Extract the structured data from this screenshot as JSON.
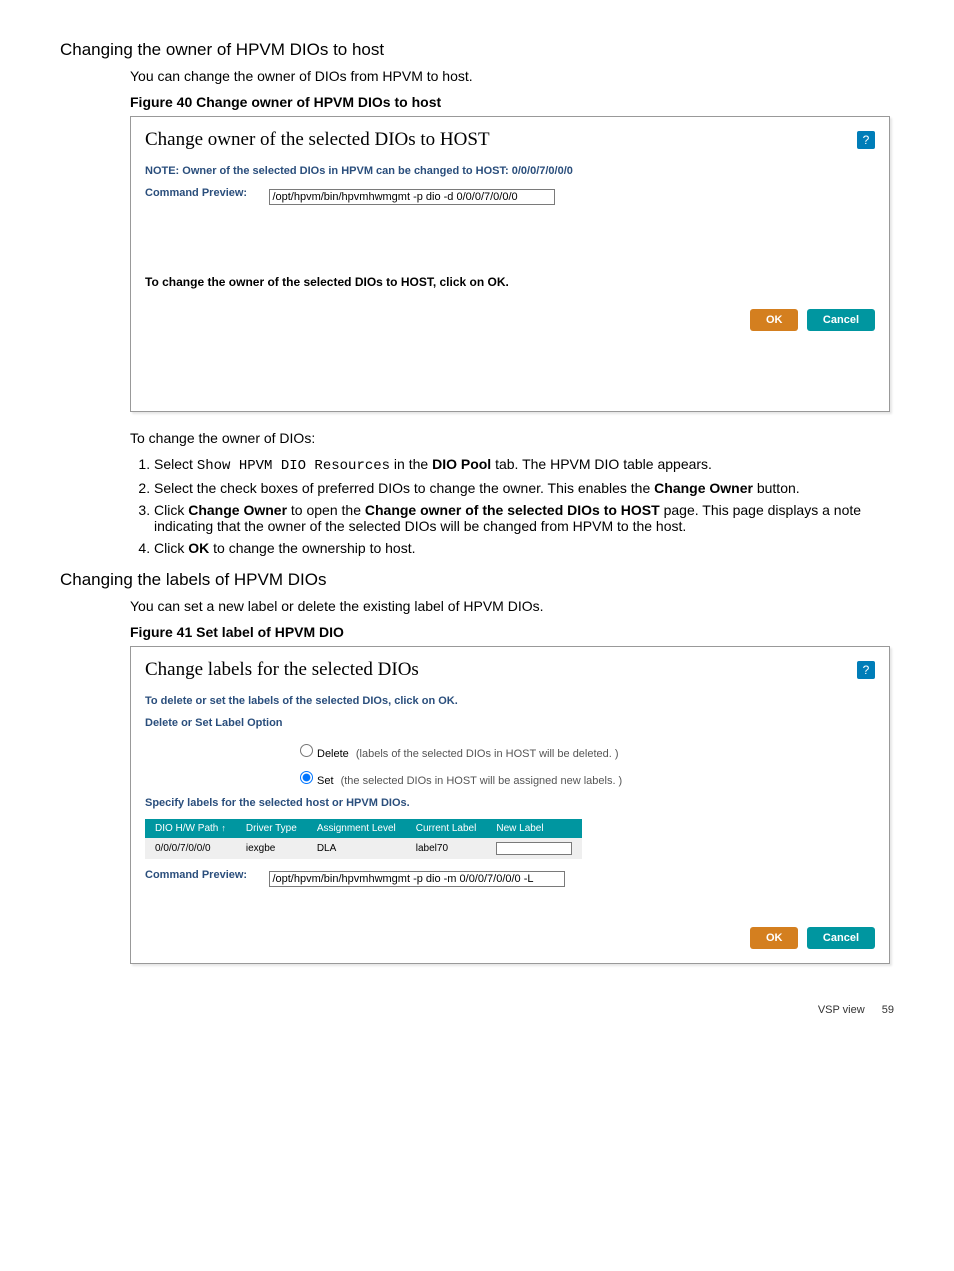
{
  "sections": {
    "s1_heading": "Changing the owner of HPVM DIOs to host",
    "s1_intro": "You can change the owner of DIOs from HPVM to host.",
    "fig40_caption": "Figure 40 Change owner of HPVM DIOs to host",
    "s1_after": "To change the owner of DIOs:",
    "s2_heading": "Changing the labels of HPVM DIOs",
    "s2_intro": "You can set a new label or delete the existing label of HPVM DIOs.",
    "fig41_caption": "Figure 41 Set label of HPVM DIO"
  },
  "fig40": {
    "title": "Change owner of the selected DIOs to HOST",
    "note": "NOTE: Owner of the selected DIOs in HPVM can be changed to HOST: 0/0/0/7/0/0/0",
    "cmd_label": "Command Preview:",
    "cmd_value": "/opt/hpvm/bin/hpvmhwmgmt -p dio -d 0/0/0/7/0/0/0",
    "instruction": "To change the owner of the selected DIOs to HOST, click on OK.",
    "ok": "OK",
    "cancel": "Cancel",
    "help": "?"
  },
  "steps": {
    "s1_pre": "Select ",
    "s1_code": "Show HPVM DIO Resources",
    "s1_mid": " in the ",
    "s1_bold": "DIO Pool",
    "s1_post": " tab. The HPVM DIO table appears.",
    "s2_pre": "Select the check boxes of preferred DIOs to change the owner. This enables the ",
    "s2_bold": "Change Owner",
    "s2_post": " button.",
    "s3_pre": "Click ",
    "s3_bold1": "Change Owner",
    "s3_mid": " to open the ",
    "s3_bold2": "Change owner of the selected DIOs to HOST",
    "s3_post": " page. This page displays a note indicating that the owner of the selected DIOs will be changed from HPVM to the host.",
    "s4_pre": "Click ",
    "s4_bold": "OK",
    "s4_post": " to change the ownership to host."
  },
  "fig41": {
    "title": "Change labels for the selected DIOs",
    "help": "?",
    "instruction_top": "To delete or set the labels of the selected DIOs, click on OK.",
    "option_label": "Delete or Set Label Option",
    "delete_label": "Delete",
    "delete_hint": "(labels of the selected DIOs in HOST will be deleted. )",
    "set_label": "Set",
    "set_hint": "(the selected DIOs in HOST will be assigned new labels. )",
    "specify_label": "Specify labels for the selected host or HPVM DIOs.",
    "cols": {
      "hw": "DIO H/W Path",
      "driver": "Driver Type",
      "assign": "Assignment Level",
      "current": "Current Label",
      "newl": "New Label"
    },
    "row": {
      "hw": "0/0/0/7/0/0/0",
      "driver": "iexgbe",
      "assign": "DLA",
      "current": "label70",
      "newl": ""
    },
    "cmd_label": "Command Preview:",
    "cmd_value": "/opt/hpvm/bin/hpvmhwmgmt -p dio -m 0/0/0/7/0/0/0 -L",
    "ok": "OK",
    "cancel": "Cancel"
  },
  "footer": {
    "section": "VSP view",
    "page": "59"
  }
}
